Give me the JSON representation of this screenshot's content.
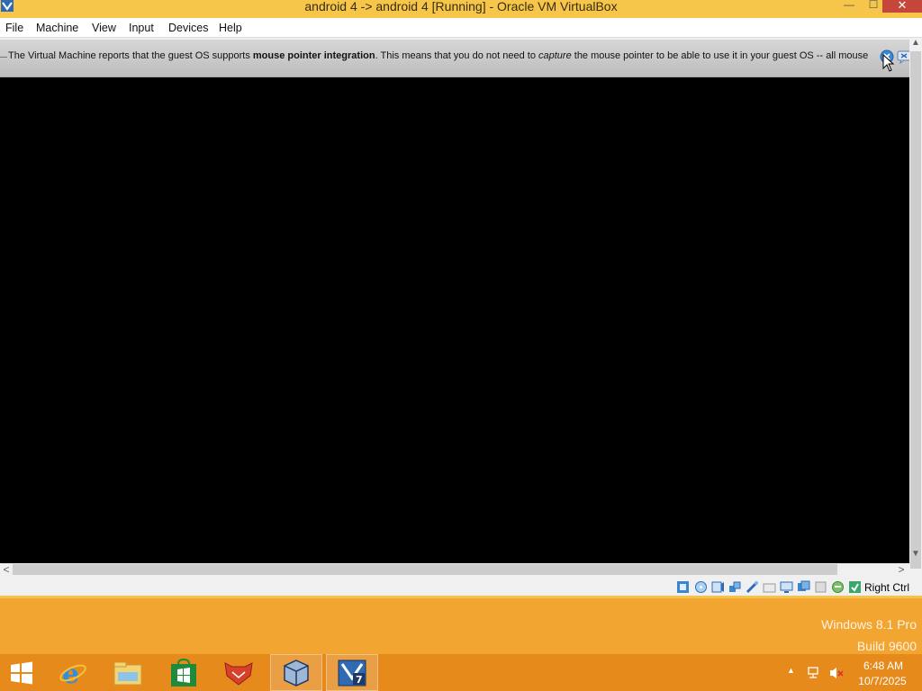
{
  "window": {
    "title": "android 4 -> android 4 [Running] - Oracle VM VirtualBox",
    "minimize_glyph": "—",
    "maximize_glyph": "☐",
    "close_glyph": "✕"
  },
  "menubar": {
    "items": [
      "File",
      "Machine",
      "View",
      "Input",
      "Devices",
      "Help"
    ]
  },
  "notice": {
    "part1": "The Virtual Machine reports that the guest OS supports ",
    "bold": "mouse pointer integration",
    "part2": ". This means that you do not need to ",
    "italic": "capture",
    "part3": " the mouse pointer to be able to use it in your guest OS -- all mouse"
  },
  "scrollbar": {
    "up": "▲",
    "down": "▼",
    "left": "<",
    "right": ">"
  },
  "statusbar": {
    "icons": [
      "hard-disk-icon",
      "optical-drive-icon",
      "audio-icon",
      "network-icon",
      "usb-icon",
      "shared-folders-icon",
      "display-icon",
      "video-capture-icon",
      "virtualization-icon",
      "mouse-integration-icon",
      "host-key-icon"
    ],
    "host_key": "Right Ctrl"
  },
  "desktop": {
    "watermark_line1": "Windows 8.1 Pro",
    "watermark_line2": "Build 9600"
  },
  "taskbar": {
    "items": [
      "start-icon",
      "internet-explorer-icon",
      "file-explorer-icon",
      "store-icon",
      "fox-app-icon",
      "virtualbox-icon",
      "virtualbox-vm-icon"
    ],
    "time": "6:48 AM",
    "date": "10/7/2025"
  },
  "colors": {
    "titlebar": "#f5c64a",
    "taskbar": "#e78a1c",
    "desktop": "#f3a531",
    "vm_screen": "#000000"
  }
}
